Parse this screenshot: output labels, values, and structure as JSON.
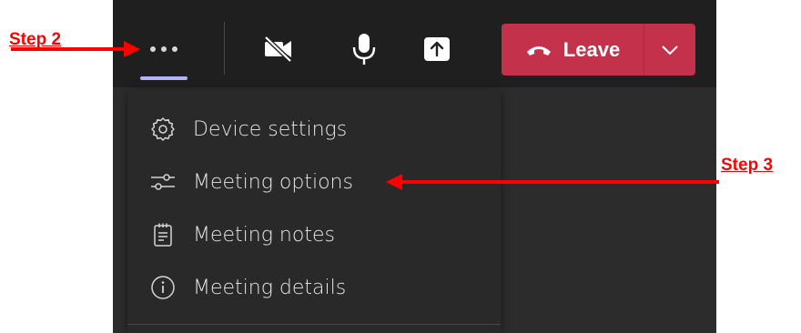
{
  "annotations": {
    "step2": "Step 2",
    "step3": "Step 3",
    "arrow_color": "#ff0000"
  },
  "toolbar": {
    "more_icon": "more-horizontal-icon",
    "camera_icon": "video-off-icon",
    "mic_icon": "microphone-icon",
    "share_icon": "share-tray-icon",
    "leave_label": "Leave",
    "leave_icon": "phone-hangup-icon",
    "leave_caret_icon": "chevron-down-icon",
    "leave_color": "#c4314b",
    "accent_underline_color": "#b2b3ff"
  },
  "menu": {
    "items": [
      {
        "label": "Device settings",
        "icon": "gear-icon"
      },
      {
        "label": "Meeting options",
        "icon": "sliders-icon"
      },
      {
        "label": "Meeting notes",
        "icon": "notes-icon"
      },
      {
        "label": "Meeting details",
        "icon": "info-icon"
      }
    ]
  }
}
